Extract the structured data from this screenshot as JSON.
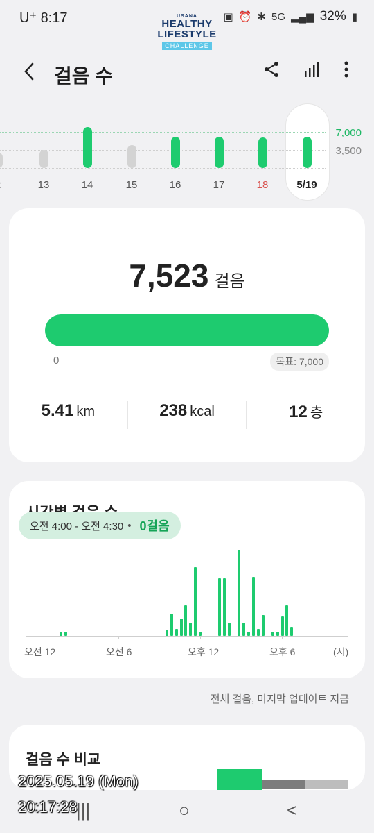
{
  "status": {
    "carrier": "U⁺",
    "time": "8:17",
    "battery": "32%",
    "network": "5G"
  },
  "logo": {
    "line1": "USANA",
    "line2": "HEALTHY",
    "line3": "LIFESTYLE",
    "line4": "CHALLENGE"
  },
  "header": {
    "title": "걸음 수"
  },
  "week": {
    "goal_label": "7,000",
    "half_label": "3,500",
    "days": [
      {
        "label": "2",
        "value": 3000,
        "met": false,
        "color": "normal"
      },
      {
        "label": "13",
        "value": 3500,
        "met": false,
        "color": "normal"
      },
      {
        "label": "14",
        "value": 7900,
        "met": true,
        "color": "normal"
      },
      {
        "label": "15",
        "value": 4400,
        "met": false,
        "color": "normal"
      },
      {
        "label": "16",
        "value": 6100,
        "met": true,
        "color": "normal"
      },
      {
        "label": "17",
        "value": 6100,
        "met": true,
        "color": "normal"
      },
      {
        "label": "18",
        "value": 5900,
        "met": true,
        "color": "red"
      },
      {
        "label": "5/19",
        "value": 6100,
        "met": true,
        "color": "selected"
      }
    ]
  },
  "summary": {
    "steps": "7,523",
    "steps_unit": "걸음",
    "progress": 1.0,
    "zero": "0",
    "goal": "목표: 7,000",
    "distance": "5.41",
    "distance_unit": "km",
    "calories": "238",
    "calories_unit": "kcal",
    "floors": "12",
    "floors_unit": "층"
  },
  "hourly": {
    "title": "시간별 걸음 수",
    "tooltip_range": "오전 4:00 - 오전 4:30",
    "tooltip_dot": "•",
    "tooltip_value": "0걸음",
    "axis_labels": [
      "오전 12",
      "오전 6",
      "오후 12",
      "오후 6",
      "(시)"
    ],
    "bars": [
      0,
      0,
      0,
      0,
      0,
      0,
      0,
      5,
      5,
      0,
      0,
      0,
      0,
      0,
      0,
      0,
      0,
      0,
      0,
      0,
      0,
      0,
      0,
      0,
      0,
      0,
      0,
      0,
      0,
      6,
      25,
      8,
      20,
      35,
      15,
      78,
      5,
      0,
      0,
      0,
      65,
      65,
      15,
      0,
      98,
      15,
      5,
      67,
      8,
      24,
      0,
      5,
      5,
      22,
      35,
      10,
      0,
      0,
      0,
      0,
      0,
      0,
      0,
      0
    ]
  },
  "footnote": "전체 걸음, 마지막 업데이트 지금",
  "compare": {
    "title": "걸음 수 비교"
  },
  "stamp": {
    "date": "2025.05.19 (Mon)",
    "time": "20:17:28"
  },
  "nav": {
    "recent": "|||",
    "home": "○",
    "back": "<"
  }
}
